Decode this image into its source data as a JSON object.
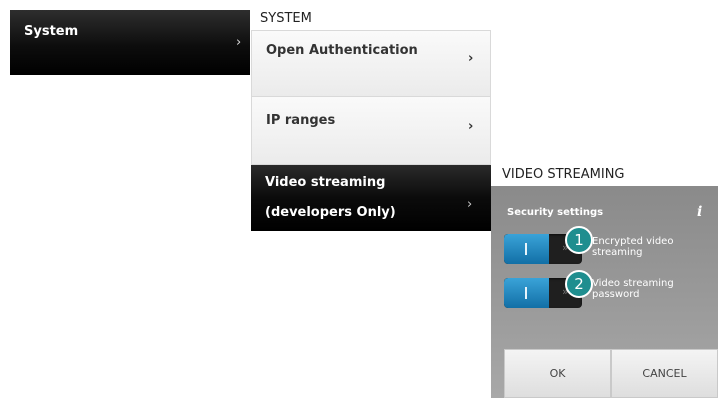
{
  "main_menu": {
    "system_label": "System",
    "chevron": "›"
  },
  "system_column": {
    "title": "SYSTEM",
    "items": [
      {
        "label": "Open Authentication",
        "chevron": "›"
      },
      {
        "label": "IP ranges",
        "chevron": "›"
      },
      {
        "label": "Video streaming (developers Only)",
        "chevron": "›"
      }
    ]
  },
  "video_streaming": {
    "title": "VIDEO STREAMING",
    "security_label": "Security settings",
    "info_icon": "i",
    "options": [
      {
        "badge": "1",
        "text": "Encrypted video streaming",
        "state": "on",
        "off_glyph": "»"
      },
      {
        "badge": "2",
        "text": "Video streaming password",
        "state": "on",
        "off_glyph": "»"
      }
    ],
    "ok_label": "OK",
    "cancel_label": "CANCEL"
  },
  "colors": {
    "toggle_on": "#1c85c2",
    "badge": "#1f8e8f",
    "dark_item": "#000000",
    "panel": "#9a9a9a"
  },
  "icons": [
    "chevron-right-icon",
    "info-icon"
  ]
}
